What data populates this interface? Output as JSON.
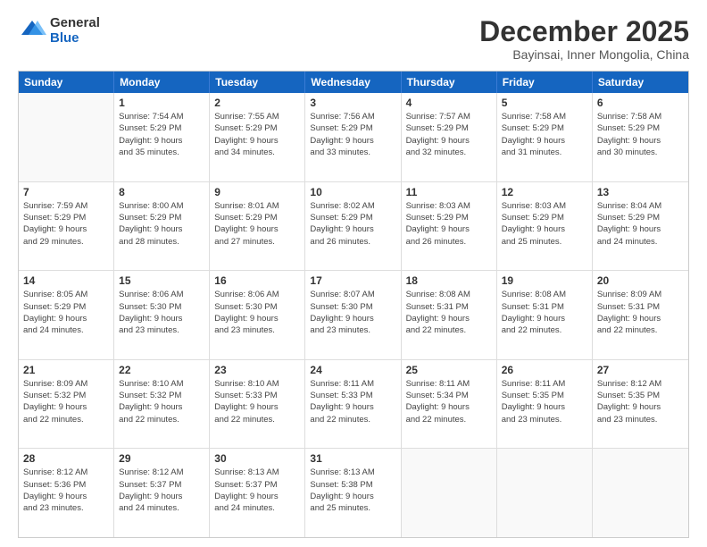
{
  "logo": {
    "general": "General",
    "blue": "Blue"
  },
  "title": "December 2025",
  "subtitle": "Bayinsai, Inner Mongolia, China",
  "headers": [
    "Sunday",
    "Monday",
    "Tuesday",
    "Wednesday",
    "Thursday",
    "Friday",
    "Saturday"
  ],
  "weeks": [
    [
      {
        "day": "",
        "info": ""
      },
      {
        "day": "1",
        "info": "Sunrise: 7:54 AM\nSunset: 5:29 PM\nDaylight: 9 hours\nand 35 minutes."
      },
      {
        "day": "2",
        "info": "Sunrise: 7:55 AM\nSunset: 5:29 PM\nDaylight: 9 hours\nand 34 minutes."
      },
      {
        "day": "3",
        "info": "Sunrise: 7:56 AM\nSunset: 5:29 PM\nDaylight: 9 hours\nand 33 minutes."
      },
      {
        "day": "4",
        "info": "Sunrise: 7:57 AM\nSunset: 5:29 PM\nDaylight: 9 hours\nand 32 minutes."
      },
      {
        "day": "5",
        "info": "Sunrise: 7:58 AM\nSunset: 5:29 PM\nDaylight: 9 hours\nand 31 minutes."
      },
      {
        "day": "6",
        "info": "Sunrise: 7:58 AM\nSunset: 5:29 PM\nDaylight: 9 hours\nand 30 minutes."
      }
    ],
    [
      {
        "day": "7",
        "info": "Sunrise: 7:59 AM\nSunset: 5:29 PM\nDaylight: 9 hours\nand 29 minutes."
      },
      {
        "day": "8",
        "info": "Sunrise: 8:00 AM\nSunset: 5:29 PM\nDaylight: 9 hours\nand 28 minutes."
      },
      {
        "day": "9",
        "info": "Sunrise: 8:01 AM\nSunset: 5:29 PM\nDaylight: 9 hours\nand 27 minutes."
      },
      {
        "day": "10",
        "info": "Sunrise: 8:02 AM\nSunset: 5:29 PM\nDaylight: 9 hours\nand 26 minutes."
      },
      {
        "day": "11",
        "info": "Sunrise: 8:03 AM\nSunset: 5:29 PM\nDaylight: 9 hours\nand 26 minutes."
      },
      {
        "day": "12",
        "info": "Sunrise: 8:03 AM\nSunset: 5:29 PM\nDaylight: 9 hours\nand 25 minutes."
      },
      {
        "day": "13",
        "info": "Sunrise: 8:04 AM\nSunset: 5:29 PM\nDaylight: 9 hours\nand 24 minutes."
      }
    ],
    [
      {
        "day": "14",
        "info": "Sunrise: 8:05 AM\nSunset: 5:29 PM\nDaylight: 9 hours\nand 24 minutes."
      },
      {
        "day": "15",
        "info": "Sunrise: 8:06 AM\nSunset: 5:30 PM\nDaylight: 9 hours\nand 23 minutes."
      },
      {
        "day": "16",
        "info": "Sunrise: 8:06 AM\nSunset: 5:30 PM\nDaylight: 9 hours\nand 23 minutes."
      },
      {
        "day": "17",
        "info": "Sunrise: 8:07 AM\nSunset: 5:30 PM\nDaylight: 9 hours\nand 23 minutes."
      },
      {
        "day": "18",
        "info": "Sunrise: 8:08 AM\nSunset: 5:31 PM\nDaylight: 9 hours\nand 22 minutes."
      },
      {
        "day": "19",
        "info": "Sunrise: 8:08 AM\nSunset: 5:31 PM\nDaylight: 9 hours\nand 22 minutes."
      },
      {
        "day": "20",
        "info": "Sunrise: 8:09 AM\nSunset: 5:31 PM\nDaylight: 9 hours\nand 22 minutes."
      }
    ],
    [
      {
        "day": "21",
        "info": "Sunrise: 8:09 AM\nSunset: 5:32 PM\nDaylight: 9 hours\nand 22 minutes."
      },
      {
        "day": "22",
        "info": "Sunrise: 8:10 AM\nSunset: 5:32 PM\nDaylight: 9 hours\nand 22 minutes."
      },
      {
        "day": "23",
        "info": "Sunrise: 8:10 AM\nSunset: 5:33 PM\nDaylight: 9 hours\nand 22 minutes."
      },
      {
        "day": "24",
        "info": "Sunrise: 8:11 AM\nSunset: 5:33 PM\nDaylight: 9 hours\nand 22 minutes."
      },
      {
        "day": "25",
        "info": "Sunrise: 8:11 AM\nSunset: 5:34 PM\nDaylight: 9 hours\nand 22 minutes."
      },
      {
        "day": "26",
        "info": "Sunrise: 8:11 AM\nSunset: 5:35 PM\nDaylight: 9 hours\nand 23 minutes."
      },
      {
        "day": "27",
        "info": "Sunrise: 8:12 AM\nSunset: 5:35 PM\nDaylight: 9 hours\nand 23 minutes."
      }
    ],
    [
      {
        "day": "28",
        "info": "Sunrise: 8:12 AM\nSunset: 5:36 PM\nDaylight: 9 hours\nand 23 minutes."
      },
      {
        "day": "29",
        "info": "Sunrise: 8:12 AM\nSunset: 5:37 PM\nDaylight: 9 hours\nand 24 minutes."
      },
      {
        "day": "30",
        "info": "Sunrise: 8:13 AM\nSunset: 5:37 PM\nDaylight: 9 hours\nand 24 minutes."
      },
      {
        "day": "31",
        "info": "Sunrise: 8:13 AM\nSunset: 5:38 PM\nDaylight: 9 hours\nand 25 minutes."
      },
      {
        "day": "",
        "info": ""
      },
      {
        "day": "",
        "info": ""
      },
      {
        "day": "",
        "info": ""
      }
    ]
  ]
}
